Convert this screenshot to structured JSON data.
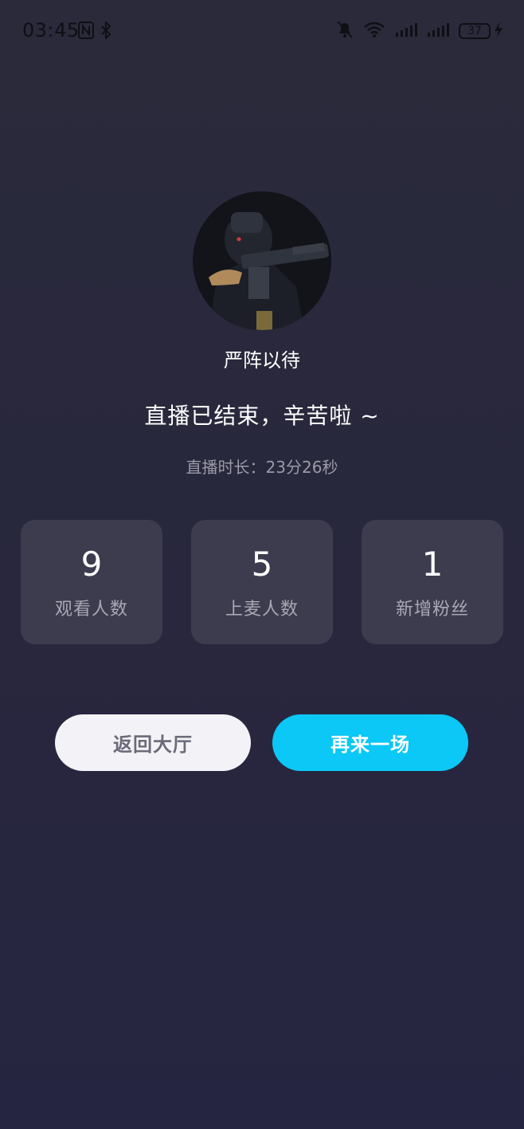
{
  "status_bar": {
    "time": "03:45",
    "battery": "37"
  },
  "profile": {
    "name": "严阵以待"
  },
  "message": {
    "headline": "直播已结束，辛苦啦 ~",
    "duration": "直播时长：23分26秒"
  },
  "stats": [
    {
      "value": "9",
      "label": "观看人数"
    },
    {
      "value": "5",
      "label": "上麦人数"
    },
    {
      "value": "1",
      "label": "新增粉丝"
    }
  ],
  "actions": {
    "back_label": "返回大厅",
    "again_label": "再来一场"
  },
  "colors": {
    "background": "#29283d",
    "card": "#3d3c4e",
    "accent": "#0bc8f6",
    "secondary_button": "#f3f3f7"
  }
}
